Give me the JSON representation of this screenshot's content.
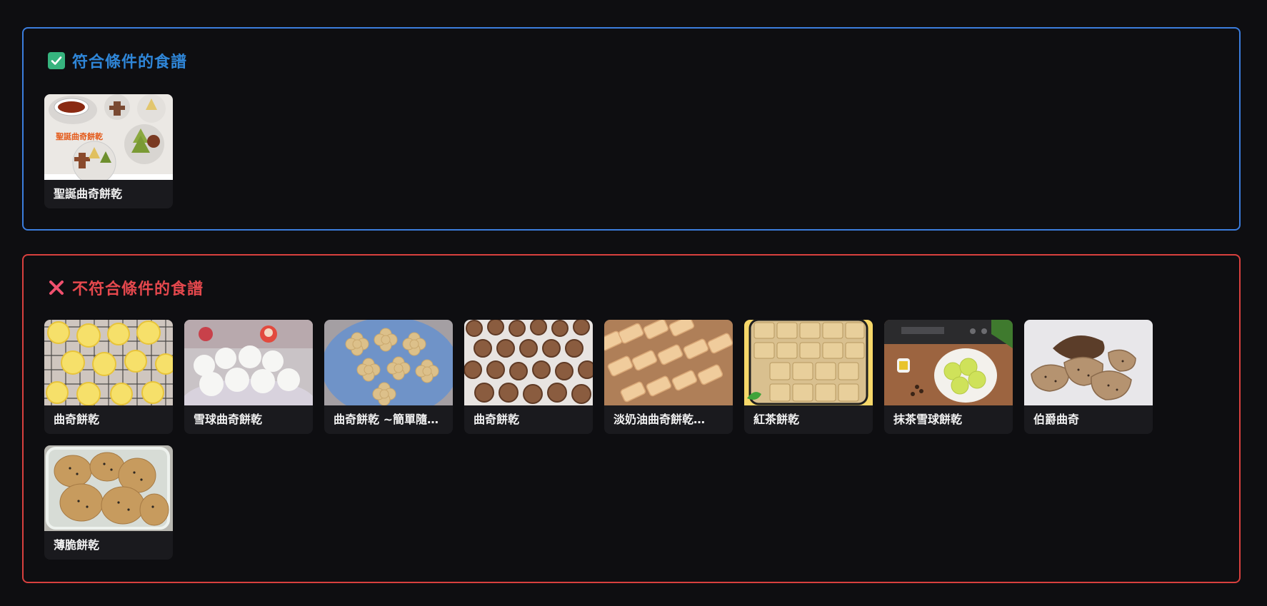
{
  "sections": {
    "match": {
      "title": "符合條件的食譜",
      "accent_color": "#3b7ddd",
      "icon": "check-icon",
      "recipes": [
        {
          "name": "聖誕曲奇餅乾",
          "thumb_caption": "聖誕曲奇餅乾"
        }
      ]
    },
    "nomatch": {
      "title": "不符合條件的食譜",
      "accent_color": "#d8403e",
      "icon": "cross-icon",
      "recipes": [
        {
          "name": "曲奇餅乾"
        },
        {
          "name": "雪球曲奇餅乾"
        },
        {
          "name": "曲奇餅乾 ~簡單隨…"
        },
        {
          "name": "曲奇餅乾"
        },
        {
          "name": "淡奶油曲奇餅乾…"
        },
        {
          "name": "紅茶餅乾"
        },
        {
          "name": "抹茶雪球餅乾"
        },
        {
          "name": "伯爵曲奇"
        },
        {
          "name": "薄脆餅乾"
        }
      ]
    }
  }
}
